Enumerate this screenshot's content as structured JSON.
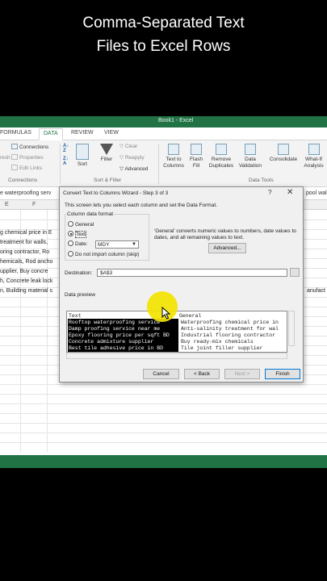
{
  "caption": {
    "line1": "Comma-Separated Text",
    "line2": "Files to Excel Rows"
  },
  "window": {
    "title": "Book1 - Excel"
  },
  "ribbon_tabs": [
    "FORMULAS",
    "DATA",
    "REVIEW",
    "VIEW"
  ],
  "active_tab": "DATA",
  "ribbon": {
    "connections": {
      "connections": "Connections",
      "properties": "Properties",
      "edit_links": "Edit Links",
      "refresh": "resh",
      "group": "Connections"
    },
    "sort_filter": {
      "sort": "Sort",
      "filter": "Filter",
      "clear": "Clear",
      "reapply": "Reapply",
      "advanced": "Advanced",
      "group": "Sort & Filter"
    },
    "data_tools": {
      "text_to_columns_1": "Text to",
      "text_to_columns_2": "Columns",
      "flash_fill_1": "Flash",
      "flash_fill_2": "Fill",
      "remove_dup_1": "Remove",
      "remove_dup_2": "Duplicates",
      "validation_1": "Data",
      "validation_2": "Validation",
      "consolidate": "Consolidate",
      "whatif_1": "What-If",
      "whatif_2": "Analysis",
      "group": "Data Tools"
    }
  },
  "formula_bar": {
    "left": "e waterproofing serv",
    "right": "pool wal"
  },
  "columns": [
    "E",
    "F"
  ],
  "sheet_rows_left": [
    "g chemical price in E",
    "treatment for walls,",
    "oring contractor, Ro",
    "hemicals, Rod ancho",
    "upplier, Buy concre",
    "h, Concrete leak lock",
    "n, Building material s"
  ],
  "sheet_rows_right": [
    "",
    "",
    "",
    "",
    "",
    "",
    "anufact"
  ],
  "dialog": {
    "title": "Convert Text to Columns Wizard - Step 3 of 3",
    "help": "?",
    "close": "✕",
    "intro": "This screen lets you select each column and set the Data Format.",
    "format_label": "Column data format",
    "options": [
      "General",
      "Text",
      "Date:",
      "Do not import column (skip)"
    ],
    "selected_option": "Text",
    "date_format": "MDY",
    "general_note": "'General' converts numeric values to numbers, date values to dates, and all remaining values to text.",
    "advanced_button": "Advanced...",
    "destination_label": "Destination:",
    "destination_value": "$A$3",
    "preview_label": "Data preview",
    "preview_headers": [
      "Text",
      "General"
    ],
    "preview_rows": [
      [
        "Rooftop waterproofing service",
        "Waterproofing chemical price in"
      ],
      [
        "Damp proofing service near me",
        "Anti-salinity treatment for wal"
      ],
      [
        "Epoxy flooring price per sqft BD",
        "Industrial flooring contractor"
      ],
      [
        "Concrete admixture supplier",
        "Buy ready-mix chemicals"
      ],
      [
        "Best tile adhesive price in BD",
        "Tile joint filler supplier"
      ]
    ],
    "buttons": {
      "cancel": "Cancel",
      "back": "< Back",
      "next": "Next >",
      "finish": "Finish"
    }
  },
  "colors": {
    "excel_green": "#217346",
    "pointer_highlight": "#f3e400",
    "selected_column": "#000000"
  }
}
